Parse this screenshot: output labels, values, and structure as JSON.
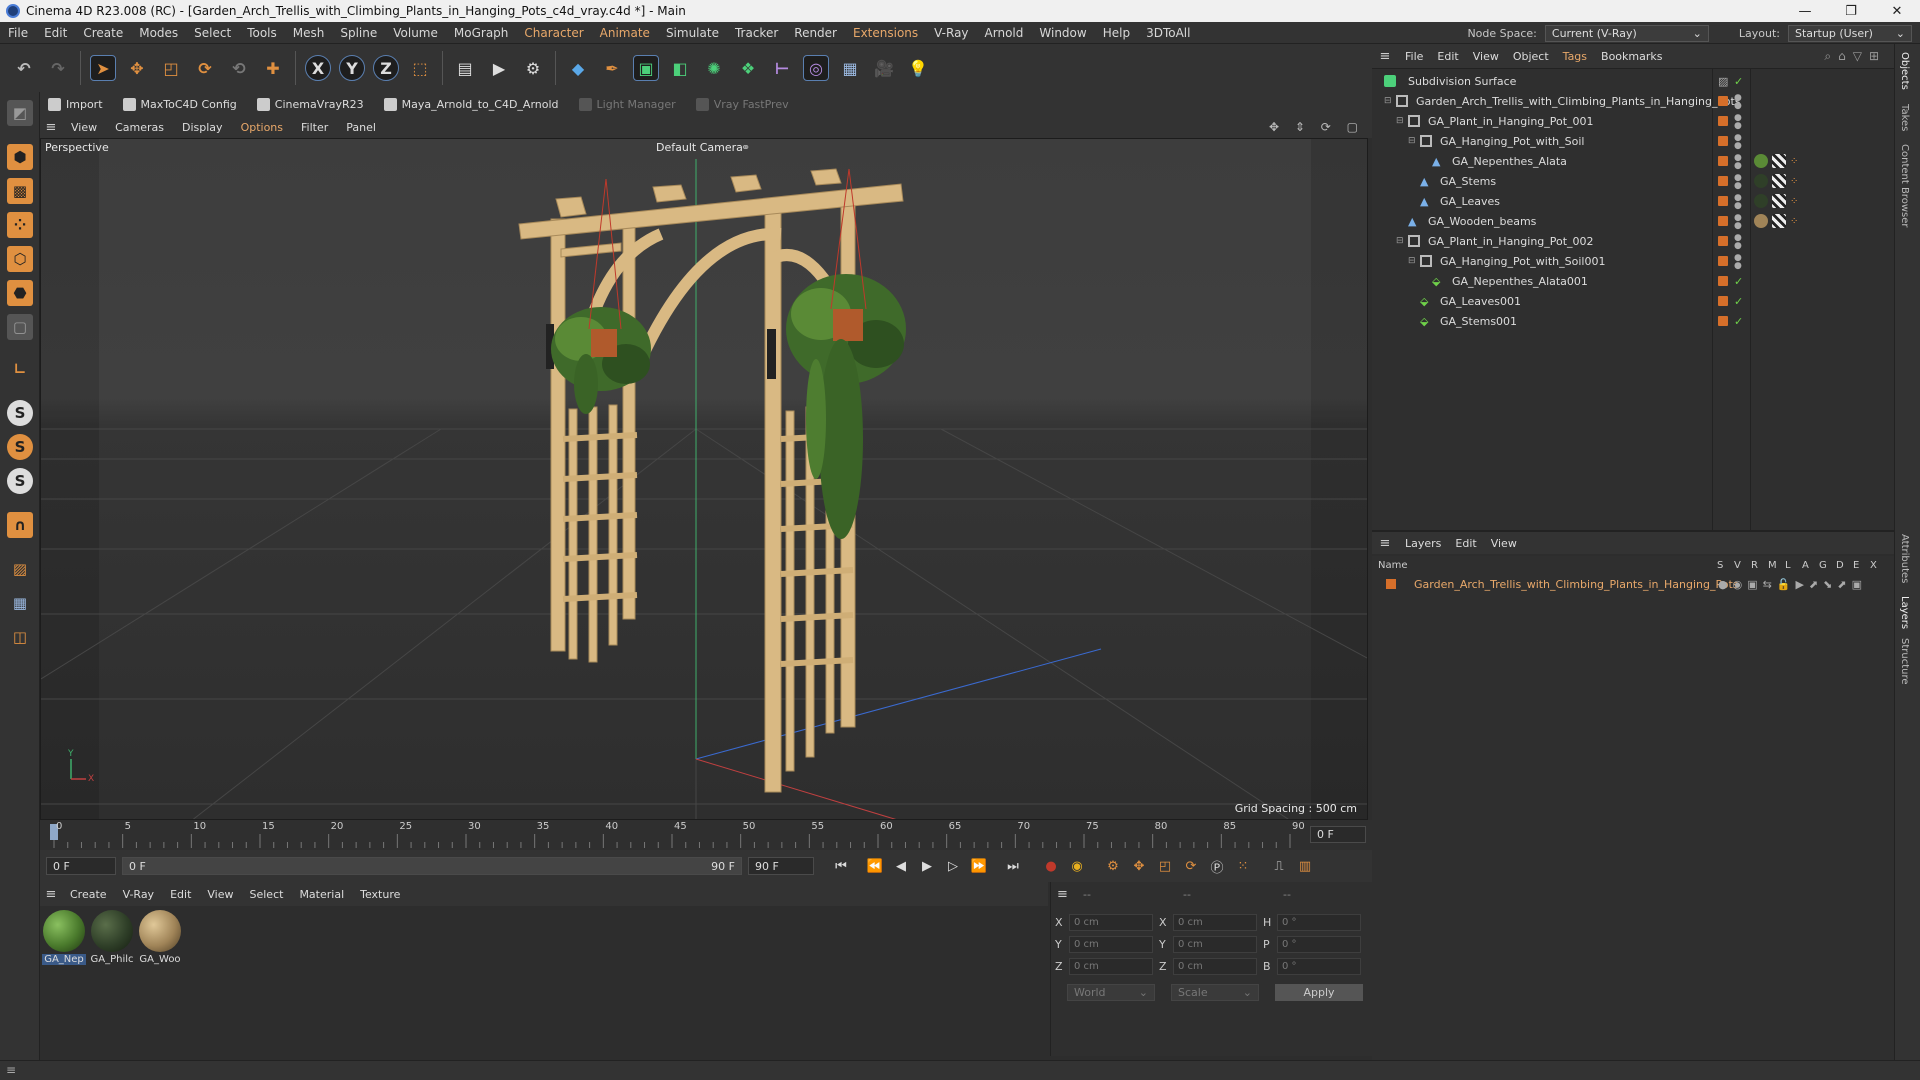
{
  "window": {
    "title": "Cinema 4D R23.008 (RC) - [Garden_Arch_Trellis_with_Climbing_Plants_in_Hanging_Pots_c4d_vray.c4d *] - Main",
    "controls": [
      "—",
      "❐",
      "✕"
    ]
  },
  "menubar": {
    "items": [
      "File",
      "Edit",
      "Create",
      "Modes",
      "Select",
      "Tools",
      "Mesh",
      "Spline",
      "Volume",
      "MoGraph",
      "Character",
      "Animate",
      "Simulate",
      "Tracker",
      "Render",
      "Extensions",
      "V-Ray",
      "Arnold",
      "Window",
      "Help",
      "3DToAll"
    ],
    "highlighted": [
      "Character",
      "Animate",
      "Extensions"
    ],
    "node_space_label": "Node Space:",
    "node_space_value": "Current (V-Ray)",
    "layout_label": "Layout:",
    "layout_value": "Startup (User)"
  },
  "plugins": {
    "items": [
      {
        "label": "Import",
        "enabled": true
      },
      {
        "label": "MaxToC4D Config",
        "enabled": true
      },
      {
        "label": "CinemaVrayR23",
        "enabled": true
      },
      {
        "label": "Maya_Arnold_to_C4D_Arnold",
        "enabled": true
      },
      {
        "label": "Light Manager",
        "enabled": false
      },
      {
        "label": "Vray FastPrev",
        "enabled": false
      }
    ]
  },
  "viewport": {
    "menu": [
      "View",
      "Cameras",
      "Display",
      "Options",
      "Filter",
      "Panel"
    ],
    "menu_highlighted": "Options",
    "view_name": "Perspective",
    "camera": "Default Camera",
    "grid_spacing": "Grid Spacing : 500 cm",
    "axis_y": "Y",
    "axis_x": "X"
  },
  "timeline": {
    "ticks": [
      "0",
      "5",
      "10",
      "15",
      "20",
      "25",
      "30",
      "35",
      "40",
      "45",
      "50",
      "55",
      "60",
      "65",
      "70",
      "75",
      "80",
      "85",
      "90"
    ],
    "current_frame": "0 F",
    "start_field": "0 F",
    "range_start": "0 F",
    "range_end": "90 F",
    "end_field": "90 F"
  },
  "materials": {
    "menu": [
      "Create",
      "V-Ray",
      "Edit",
      "View",
      "Select",
      "Material",
      "Texture"
    ],
    "items": [
      {
        "name": "GA_Nep",
        "color": "#4a7a2c"
      },
      {
        "name": "GA_Philc",
        "color": "#2f3f28"
      },
      {
        "name": "GA_Woo",
        "color": "#a08458"
      }
    ]
  },
  "coords": {
    "header": [
      "--",
      "--",
      "--"
    ],
    "rows": [
      {
        "a": "X",
        "av": "0 cm",
        "b": "X",
        "bv": "0 cm",
        "c": "H",
        "cv": "0 °"
      },
      {
        "a": "Y",
        "av": "0 cm",
        "b": "Y",
        "bv": "0 cm",
        "c": "P",
        "cv": "0 °"
      },
      {
        "a": "Z",
        "av": "0 cm",
        "b": "Z",
        "bv": "0 cm",
        "c": "B",
        "cv": "0 °"
      }
    ],
    "space": "World",
    "mode": "Scale",
    "apply": "Apply"
  },
  "objects": {
    "menu": [
      "File",
      "Edit",
      "View",
      "Object",
      "Tags",
      "Bookmarks"
    ],
    "menu_highlighted": "Tags",
    "tree": [
      {
        "name": "Subdivision Surface",
        "type": "subdiv"
      },
      {
        "name": "Garden_Arch_Trellis_with_Climbing_Plants_in_Hanging_Pots",
        "type": "null"
      },
      {
        "name": "GA_Plant_in_Hanging_Pot_001",
        "type": "null"
      },
      {
        "name": "GA_Hanging_Pot_with_Soil",
        "type": "null"
      },
      {
        "name": "GA_Nepenthes_Alata",
        "type": "poly"
      },
      {
        "name": "GA_Stems",
        "type": "poly"
      },
      {
        "name": "GA_Leaves",
        "type": "poly"
      },
      {
        "name": "GA_Wooden_beams",
        "type": "poly"
      },
      {
        "name": "GA_Plant_in_Hanging_Pot_002",
        "type": "null"
      },
      {
        "name": "GA_Hanging_Pot_with_Soil001",
        "type": "null"
      },
      {
        "name": "GA_Nepenthes_Alata001",
        "type": "inst"
      },
      {
        "name": "GA_Leaves001",
        "type": "inst"
      },
      {
        "name": "GA_Stems001",
        "type": "inst"
      }
    ]
  },
  "layers": {
    "menu": [
      "Layers",
      "Edit",
      "View"
    ],
    "columns": [
      "Name",
      "S",
      "V",
      "R",
      "M",
      "L",
      "A",
      "G",
      "D",
      "E",
      "X"
    ],
    "rows": [
      {
        "name": "Garden_Arch_Trellis_with_Climbing_Plants_in_Hanging_Pots",
        "color": "#d66f2a"
      }
    ]
  },
  "side_tabs": [
    "Objects",
    "Takes",
    "Content Browser",
    "Attributes",
    "Layers",
    "Structure"
  ],
  "colors": {
    "accent": "#e8a86a",
    "object_dot": "#d66f2a",
    "check": "#6fd04a"
  }
}
